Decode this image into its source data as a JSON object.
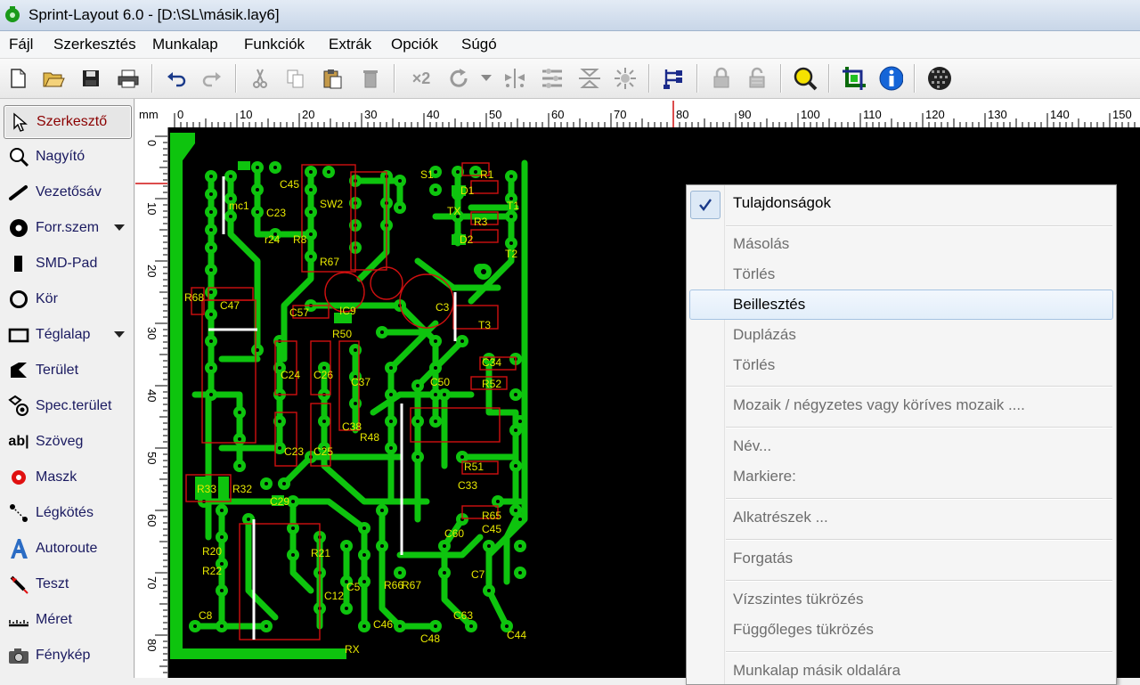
{
  "window": {
    "title": "Sprint-Layout 6.0 - [D:\\SL\\másik.lay6]"
  },
  "menu": {
    "items": [
      "Fájl",
      "Szerkesztés",
      "Munkalap",
      "Funkciók",
      "Extrák",
      "Opciók",
      "Súgó"
    ]
  },
  "toolbar": {
    "buttons": [
      "new-file-icon",
      "open-folder-icon",
      "save-icon",
      "print-icon",
      "undo-icon",
      "redo-icon",
      "cut-icon",
      "copy-icon",
      "paste-icon",
      "delete-icon",
      "duplicate-x2",
      "rotate-icon",
      "mirror-horizontal-icon",
      "mirror-vertical-icon",
      "align-icon",
      "group-icon",
      "ungroup-icon",
      "connections-icon",
      "lock-icon",
      "unlock-icon",
      "zoom-icon",
      "crop-icon",
      "info-icon",
      "texture-icon"
    ],
    "x2_label": "×2"
  },
  "tools": {
    "items": [
      {
        "label": "Szerkesztő",
        "icon": "pointer-icon",
        "active": true
      },
      {
        "label": "Nagyító",
        "icon": "magnifier-icon"
      },
      {
        "label": "Vezetősáv",
        "icon": "track-icon"
      },
      {
        "label": "Forr.szem",
        "icon": "pad-icon",
        "dropdown": true
      },
      {
        "label": "SMD-Pad",
        "icon": "smd-pad-icon"
      },
      {
        "label": "Kör",
        "icon": "circle-icon"
      },
      {
        "label": "Téglalap",
        "icon": "rectangle-icon",
        "dropdown": true
      },
      {
        "label": "Terület",
        "icon": "area-icon"
      },
      {
        "label": "Spec.terület",
        "icon": "special-area-icon"
      },
      {
        "label": "Szöveg",
        "icon": "text-icon"
      },
      {
        "label": "Maszk",
        "icon": "mask-icon"
      },
      {
        "label": "Légkötés",
        "icon": "airwire-icon"
      },
      {
        "label": "Autoroute",
        "icon": "autoroute-icon"
      },
      {
        "label": "Teszt",
        "icon": "test-probe-icon"
      },
      {
        "label": "Méret",
        "icon": "measure-icon"
      },
      {
        "label": "Fénykép",
        "icon": "camera-icon"
      }
    ]
  },
  "ruler": {
    "unit": "mm",
    "h_labels": [
      "0",
      "10",
      "20",
      "30",
      "40",
      "50",
      "60",
      "70",
      "80",
      "90",
      "100",
      "110",
      "120",
      "130",
      "140",
      "150"
    ],
    "v_labels": [
      "0",
      "10",
      "20",
      "30",
      "40",
      "50",
      "60",
      "70",
      "80"
    ]
  },
  "pcb": {
    "labels": [
      "mc1",
      "C45",
      "C23",
      "SW2",
      "r24",
      "R8",
      "R67",
      "S1",
      "R1",
      "D1",
      "TX",
      "T1",
      "R3",
      "D2",
      "T2",
      "R68",
      "C47",
      "C57",
      "IC9",
      "C3",
      "T3",
      "R50",
      "C34",
      "C24",
      "C26",
      "C37",
      "C50",
      "R52",
      "C38",
      "R48",
      "C23",
      "C25",
      "R51",
      "C33",
      "R33",
      "R32",
      "C29",
      "R65",
      "C60",
      "C45",
      "R20",
      "R22",
      "C8",
      "R21",
      "C7",
      "R66",
      "R67",
      "C46",
      "C48",
      "C44",
      "C63",
      "RX",
      "C5",
      "C12"
    ]
  },
  "context_menu": {
    "items": [
      {
        "label": "Tulajdonságok",
        "enabled": true,
        "checked": true
      },
      {
        "label": "Másolás",
        "enabled": false
      },
      {
        "label": "Törlés",
        "enabled": false
      },
      {
        "label": "Beillesztés",
        "enabled": true,
        "highlighted": true
      },
      {
        "label": "Duplázás",
        "enabled": false
      },
      {
        "label": "Törlés",
        "enabled": false
      },
      {
        "label": "Mozaik / négyzetes vagy köríves mozaik ....",
        "enabled": false
      },
      {
        "label": "Név...",
        "enabled": false
      },
      {
        "label": "Markiere:",
        "enabled": false
      },
      {
        "label": "Alkatrészek ...",
        "enabled": false
      },
      {
        "label": "Forgatás",
        "enabled": false
      },
      {
        "label": "Vízszintes tükrözés",
        "enabled": false
      },
      {
        "label": "Függőleges tükrözés",
        "enabled": false
      },
      {
        "label": "Munkalap másik oldalára",
        "enabled": false
      }
    ]
  },
  "colors": {
    "copper": "#0ec40e",
    "silkscreen": "#e8e800",
    "outline": "#d01010",
    "canvas": "#000000",
    "ruler_cursor": "#d01010"
  }
}
